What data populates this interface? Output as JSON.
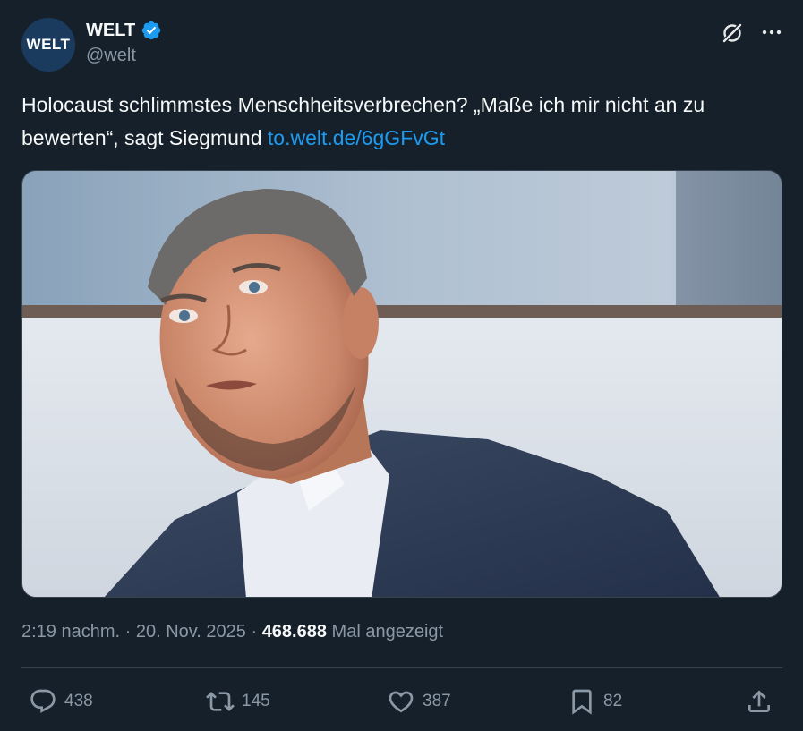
{
  "account": {
    "avatar_text": "WELT",
    "display_name": "WELT",
    "handle": "@welt",
    "verified_icon": "verified-badge-icon",
    "grok_icon": "grok-icon",
    "more_icon": "more-icon"
  },
  "tweet": {
    "text": "Holocaust schlimmstes Menschheitsverbrechen? „Maße ich mir nicht an zu bewerten“, sagt Siegmund ",
    "link": "to.welt.de/6gGFvGt"
  },
  "media": {
    "description_icon": "photo"
  },
  "meta": {
    "time": "2:19 nachm.",
    "sep1": " · ",
    "date": "20. Nov. 2025",
    "sep2": " · ",
    "views": "468.688",
    "views_label": " Mal angezeigt"
  },
  "actions": {
    "replies": "438",
    "reposts": "145",
    "likes": "387",
    "bookmarks": "82"
  },
  "colors": {
    "background": "#15202b",
    "link": "#1d9bf0",
    "muted": "#8b98a5",
    "verified": "#1d9bf0"
  }
}
